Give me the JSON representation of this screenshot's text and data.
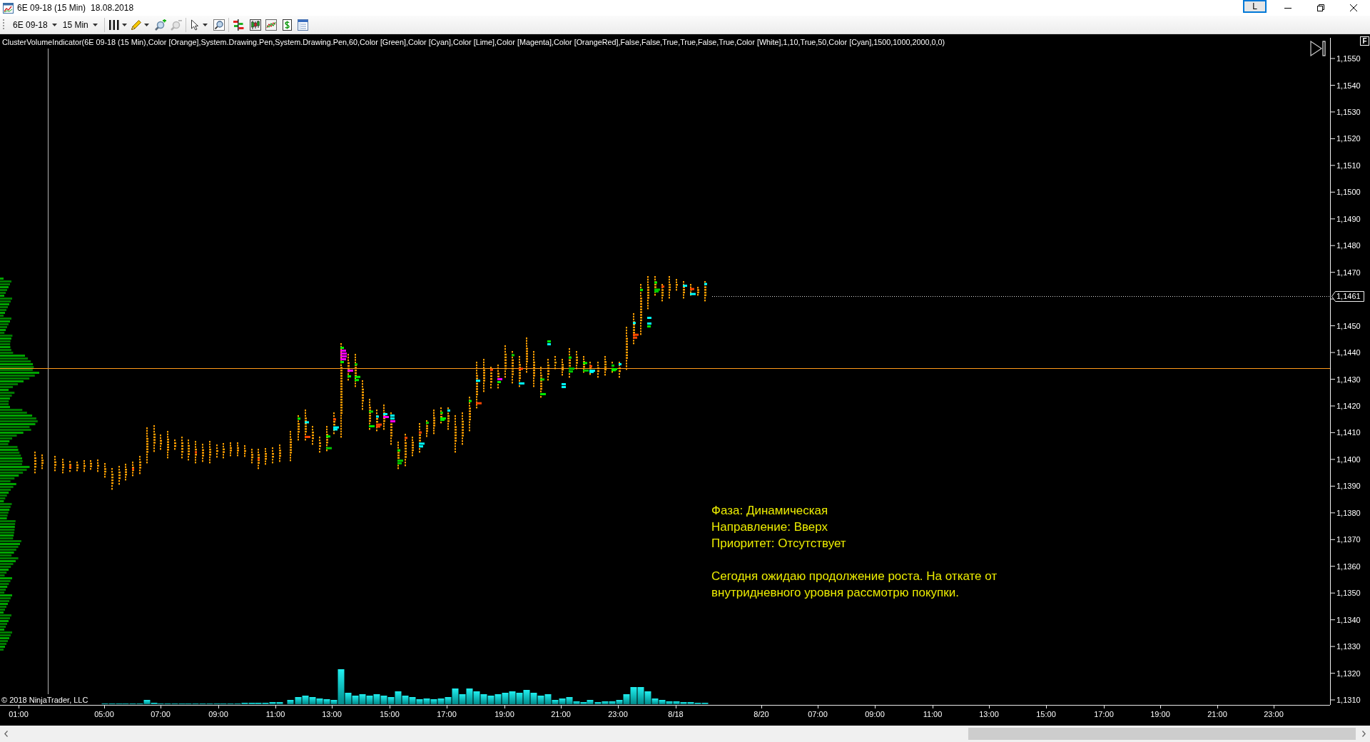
{
  "window": {
    "title": "6E 09-18 (15 Min)",
    "date": "18.08.2018",
    "layout_button": "L"
  },
  "toolbar": {
    "instrument": "6E 09-18",
    "interval": "15 Min"
  },
  "chart": {
    "indicator_label": "ClusterVolumeIndicator(6E 09-18 (15 Min),Color [Orange],System.Drawing.Pen,System.Drawing.Pen,60,Color [Green],Color [Cyan],Color [Lime],Color [Magenta],Color [OrangeRed],False,False,True,True,False,True,Color [White],1,10,True,50,Color [Cyan],1500,1000,2000,0,0)",
    "scale_button": "F",
    "price_axis": {
      "labels": [
        "1,1550",
        "1,1540",
        "1,1530",
        "1,1520",
        "1,1510",
        "1,1500",
        "1,1490",
        "1,1480",
        "1,1470",
        "1,1450",
        "1,1440",
        "1,1430",
        "1,1420",
        "1,1410",
        "1,1400",
        "1,1390",
        "1,1380",
        "1,1370",
        "1,1360",
        "1,1350",
        "1,1340",
        "1,1330",
        "1,1320",
        "1,1310"
      ],
      "current_price": "1,1461"
    },
    "time_axis": {
      "labels": [
        "01:00",
        "05:00",
        "07:00",
        "09:00",
        "11:00",
        "13:00",
        "15:00",
        "17:00",
        "19:00",
        "21:00",
        "23:00",
        "8/18",
        "8/20",
        "07:00",
        "09:00",
        "11:00",
        "13:00",
        "15:00",
        "17:00",
        "19:00",
        "21:00",
        "23:00"
      ]
    },
    "notes": {
      "lines": [
        "Фаза: Динамическая",
        "Направление: Вверх",
        "Приоритет: Отсутствует"
      ],
      "comment": "Сегодня ожидаю продолжение роста. На откате от внутридневного уровня рассмотрю покупки."
    },
    "copyright": "© 2018 NinjaTrader, LLC"
  }
}
